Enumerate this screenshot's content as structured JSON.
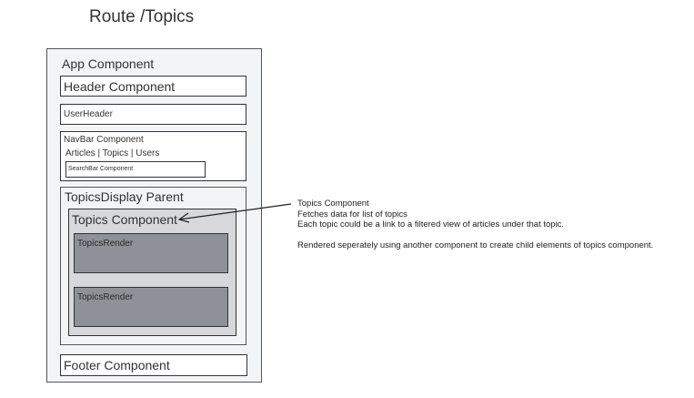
{
  "title": "Route /Topics",
  "app": {
    "label": "App Component"
  },
  "header": {
    "label": "Header Component"
  },
  "userheader": {
    "label": "UserHeader"
  },
  "navbar": {
    "label": "NavBar Component",
    "links": "Articles | Topics | Users",
    "searchbar": "SearchBar Component"
  },
  "topics_display": {
    "label": "TopicsDisplay Parent"
  },
  "topics": {
    "label": "Topics Component",
    "renders": [
      {
        "label": "TopicsRender"
      },
      {
        "label": "TopicsRender"
      }
    ]
  },
  "footer": {
    "label": "Footer Component"
  },
  "note": {
    "line1": "Topics Component",
    "line2": "Fetches data for list of topics",
    "line3": "Each topic could be a link to a filtered view of articles under that topic.",
    "line4": "Rendered seperately using another component to create child elements of topics component."
  }
}
